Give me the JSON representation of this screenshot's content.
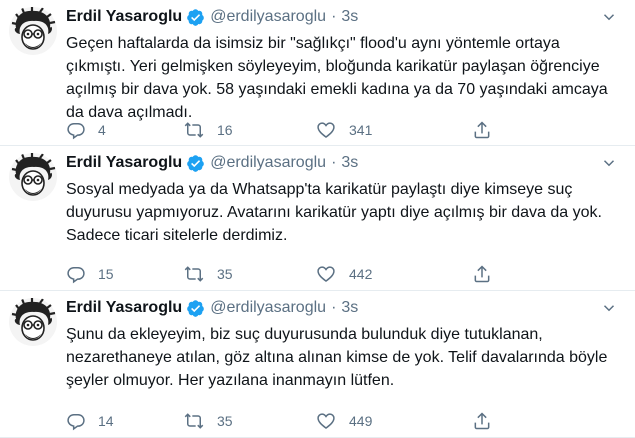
{
  "colors": {
    "accent": "#1da1f2",
    "secondary_text": "#5b7083",
    "primary_text": "#0f1419",
    "divider": "#e6ecf0"
  },
  "tweets": [
    {
      "author": "Erdil Yasaroglu",
      "handle": "@erdilyasaroglu",
      "separator": "·",
      "time": "3s",
      "text": "Geçen haftalarda da isimsiz bir \"sağlıkçı\" flood'u aynı yöntemle ortaya\nçıkmıştı. Yeri gelmişken söyleyeyim, bloğunda karikatür paylaşan öğrenciye\naçılmış bir dava yok. 58 yaşındaki emekli kadına ya da 70 yaşındaki amcaya\nda dava açılmadı.",
      "replies": "4",
      "retweets": "16",
      "likes": "341"
    },
    {
      "author": "Erdil Yasaroglu",
      "handle": "@erdilyasaroglu",
      "separator": "·",
      "time": "3s",
      "text": "Sosyal medyada ya da Whatsapp'ta karikatür paylaştı diye kimseye suç\nduyurusu yapmıyoruz. Avatarını karikatür yaptı diye açılmış bir dava da yok.\nSadece ticari sitelerle derdimiz.",
      "replies": "15",
      "retweets": "35",
      "likes": "442"
    },
    {
      "author": "Erdil Yasaroglu",
      "handle": "@erdilyasaroglu",
      "separator": "·",
      "time": "3s",
      "text": "Şunu da ekleyeyim, biz suç duyurusunda bulunduk diye tutuklanan,\nnezarethaneye atılan, göz altına alınan kimse de yok. Telif davalarında böyle\nşeyler olmuyor. Her yazılana inanmayın lütfen.",
      "replies": "14",
      "retweets": "35",
      "likes": "449"
    }
  ],
  "icons": {
    "avatar": "caricature-avatar",
    "verified": "verified-badge-icon",
    "more": "chevron-down-icon",
    "reply": "reply-icon",
    "retweet": "retweet-icon",
    "like": "heart-icon",
    "share": "share-icon"
  }
}
